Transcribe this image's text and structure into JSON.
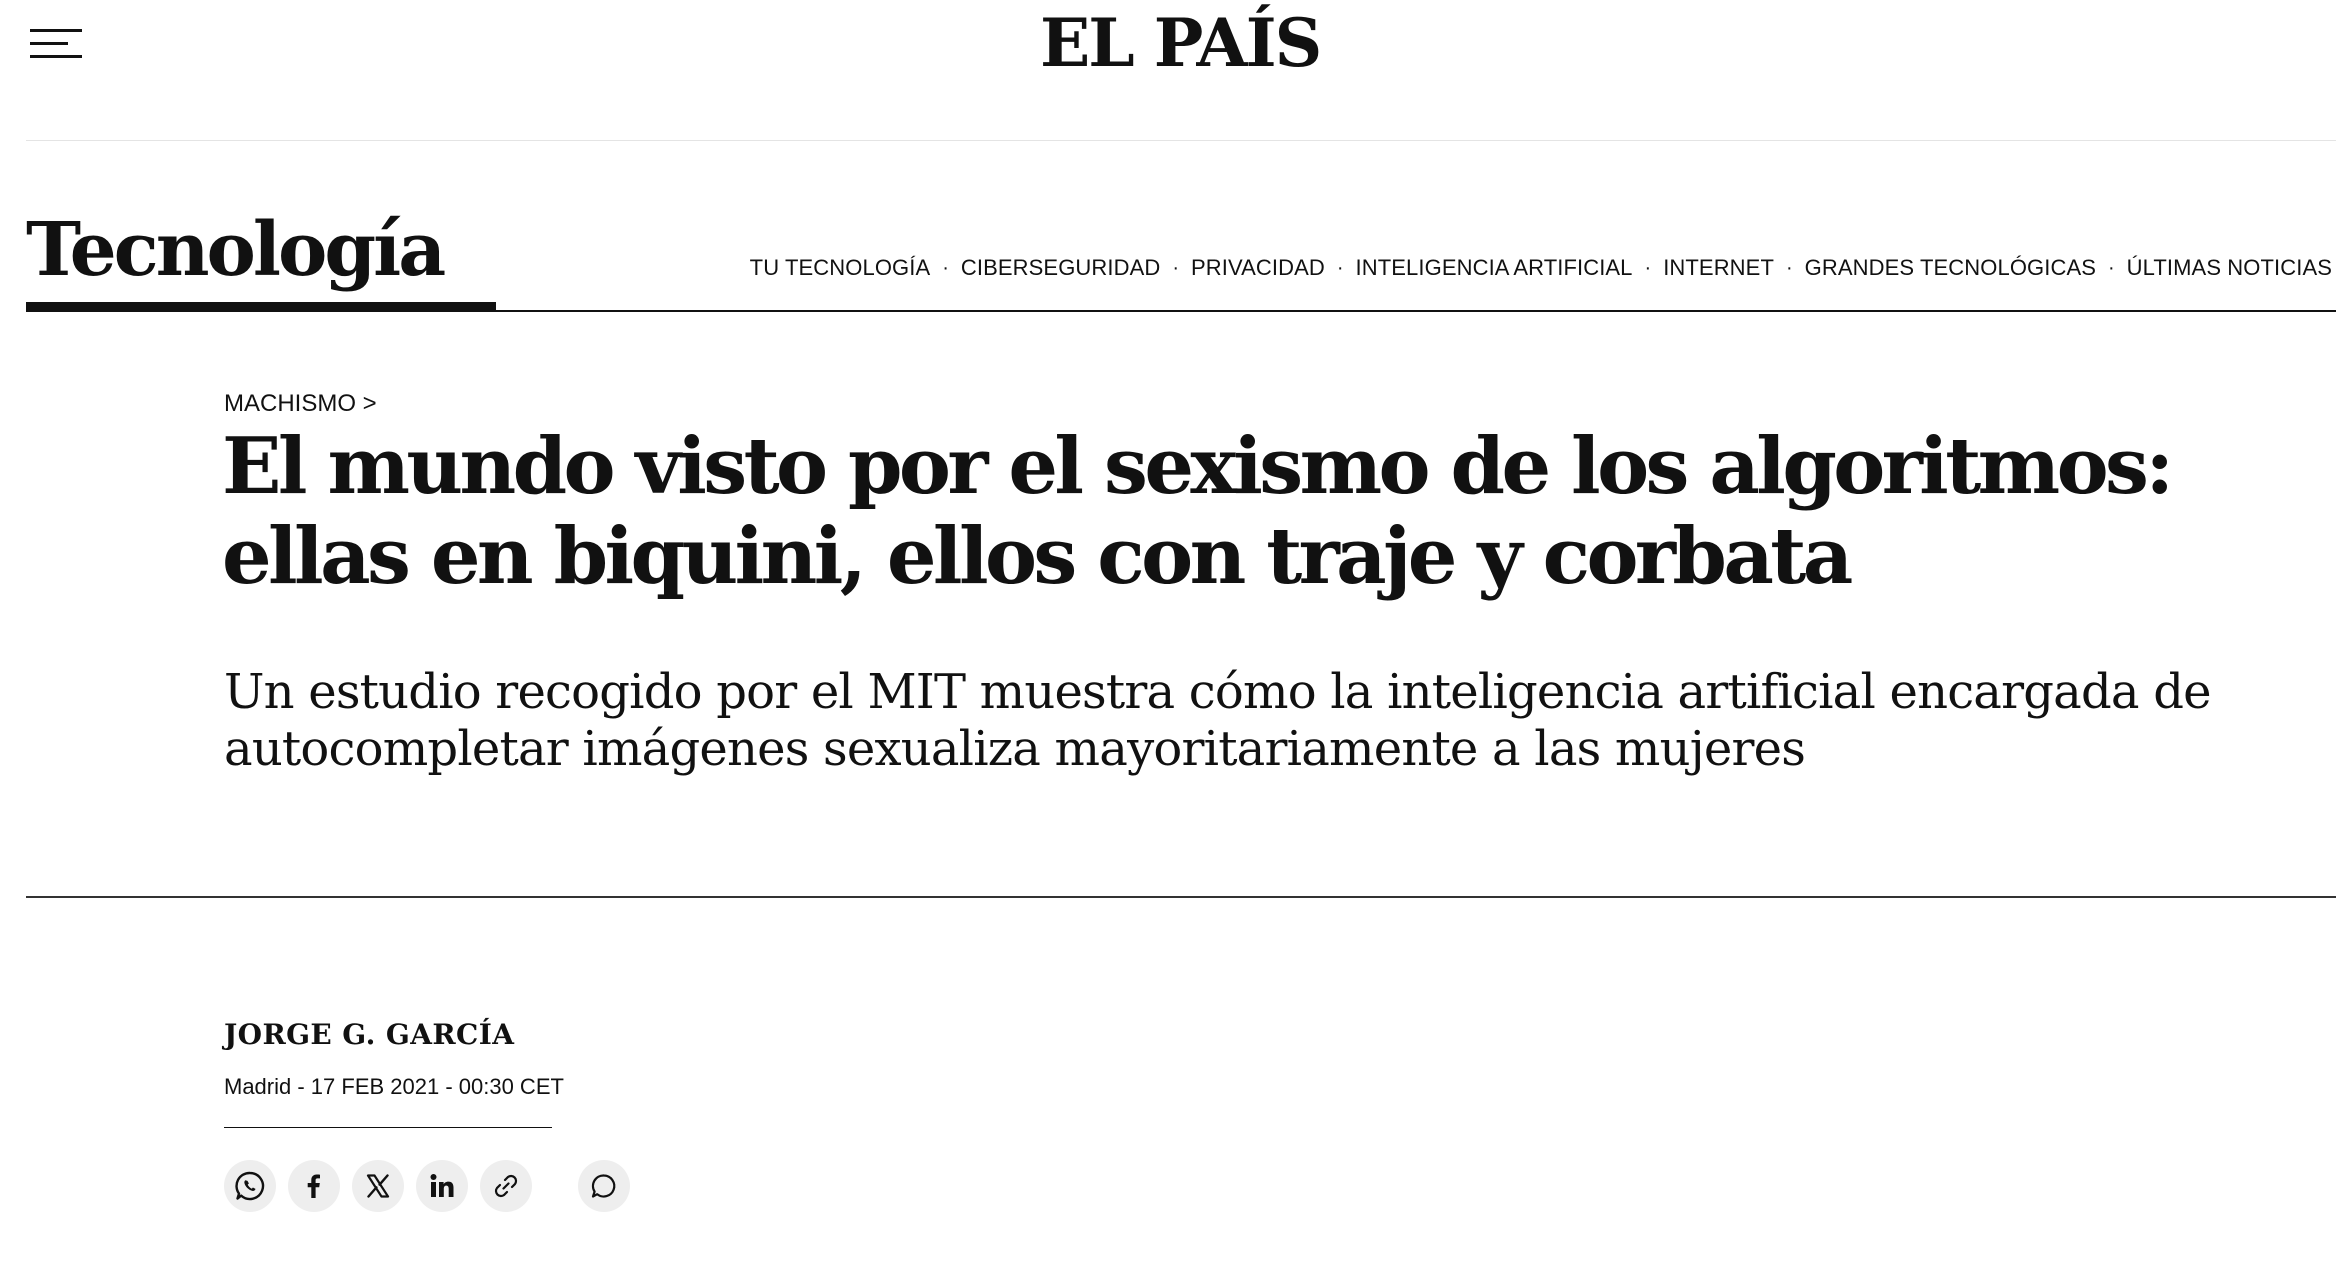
{
  "header": {
    "logo_text": "EL PAÍS",
    "menu_icon": "hamburger-menu-icon"
  },
  "section": {
    "title": "Tecnología",
    "nav": [
      {
        "label": "TU TECNOLOGÍA"
      },
      {
        "label": "CIBERSEGURIDAD"
      },
      {
        "label": "PRIVACIDAD"
      },
      {
        "label": "INTELIGENCIA ARTIFICIAL"
      },
      {
        "label": "INTERNET"
      },
      {
        "label": "GRANDES TECNOLÓGICAS"
      },
      {
        "label": "ÚLTIMAS NOTICIAS"
      }
    ],
    "separator": "·"
  },
  "article": {
    "kicker": "MACHISMO >",
    "headline_line1": "El mundo visto por el sexismo de los algoritmos:",
    "headline_line2": "ellas en biquini, ellos con traje y corbata",
    "standfirst_line1": "Un estudio recogido por el MIT muestra cómo la inteligencia artificial encargada de",
    "standfirst_line2": "autocompletar imágenes sexualiza mayoritariamente a las mujeres",
    "author": "JORGE G. GARCÍA",
    "dateline": "Madrid - 17 FEB 2021 - 00:30 CET"
  },
  "share": {
    "buttons": [
      {
        "icon": "whatsapp-icon"
      },
      {
        "icon": "facebook-icon"
      },
      {
        "icon": "x-twitter-icon"
      },
      {
        "icon": "linkedin-icon"
      },
      {
        "icon": "link-icon"
      },
      {
        "icon": "comment-icon"
      }
    ]
  },
  "colors": {
    "text": "#111111",
    "background": "#ffffff",
    "button_bg": "#eeeeee",
    "light_rule": "#e4e4e4"
  }
}
